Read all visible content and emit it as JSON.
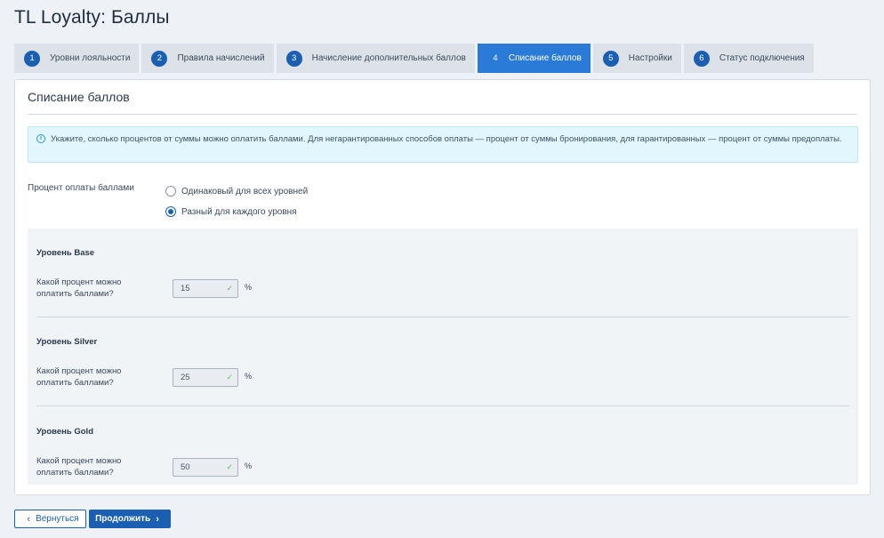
{
  "page": {
    "title": "TL Loyalty: Баллы"
  },
  "tabs": [
    {
      "num": "1",
      "label": "Уровни лояльности"
    },
    {
      "num": "2",
      "label": "Правила начислений"
    },
    {
      "num": "3",
      "label": "Начисление дополнительных баллов"
    },
    {
      "num": "4",
      "label": "Списание баллов",
      "active": true
    },
    {
      "num": "5",
      "label": "Настройки"
    },
    {
      "num": "6",
      "label": "Статус подключения"
    }
  ],
  "panel": {
    "title": "Списание баллов",
    "info_icon": "info-icon",
    "info_text": "Укажите, сколько процентов от суммы можно оплатить баллами. Для негарантированных способов оплаты — процент от суммы бронирования, для гарантированных — процент от суммы предоплаты.",
    "percent_label": "Процент оплаты баллами",
    "radio_options": [
      {
        "label": "Одинаковый для всех уровней",
        "checked": false
      },
      {
        "label": "Разный для каждого уровня",
        "checked": true
      }
    ],
    "levels": [
      {
        "title": "Уровень Base",
        "question": "Какой процент можно оплатить баллами?",
        "value": "15",
        "unit": "%"
      },
      {
        "title": "Уровень Silver",
        "question": "Какой процент можно оплатить баллами?",
        "value": "25",
        "unit": "%"
      },
      {
        "title": "Уровень Gold",
        "question": "Какой процент можно оплатить баллами?",
        "value": "50",
        "unit": "%"
      }
    ]
  },
  "buttons": {
    "back_label": "Вернуться",
    "next_label": "Продолжить",
    "back_icon": "chevron-left-icon",
    "next_icon": "chevron-right-icon"
  },
  "colors": {
    "accent": "#1b5fb3",
    "active_tab": "#2a7ad8",
    "info_bg": "#e2f6fd",
    "valid_check": "#5cb85c"
  }
}
